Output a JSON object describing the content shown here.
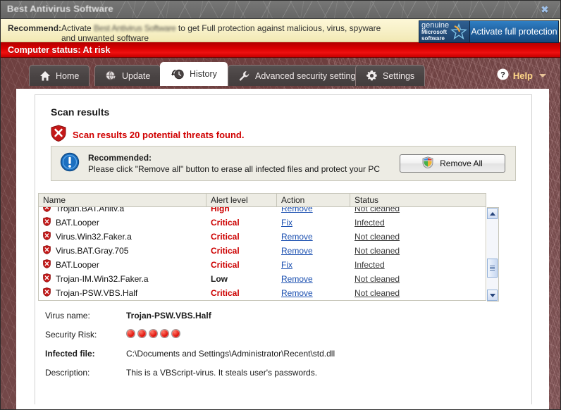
{
  "window": {
    "title": "Best Antivirus Software",
    "close_icon": "close-icon"
  },
  "recommend_bar": {
    "label": "Recommend:",
    "text_before": "Activate",
    "text_blurred": "Best Antivirus Software",
    "text_after": "to get Full protection against malicious, virus, spyware and unwanted software",
    "genuine": {
      "line1": "genuine",
      "line2": "Microsoft",
      "line3": "software"
    },
    "activate_button": "Activate full protection"
  },
  "status_bar": {
    "text": "Computer status: At risk"
  },
  "tabs": [
    {
      "label": "Home",
      "icon": "home-icon",
      "active": false
    },
    {
      "label": "Update",
      "icon": "update-globe-icon",
      "active": false
    },
    {
      "label": "History",
      "icon": "history-clock-icon",
      "active": true
    },
    {
      "label": "Advanced security settings",
      "icon": "wrench-icon",
      "active": false
    },
    {
      "label": "Settings",
      "icon": "gear-icon",
      "active": false
    }
  ],
  "help": {
    "label": "Help",
    "icon": "question-mark-icon"
  },
  "main": {
    "heading": "Scan results",
    "threat_summary": "Scan results 20 potential threats found.",
    "threat_icon": "shield-alert-icon",
    "recommended_box": {
      "icon": "info-exclamation-icon",
      "title": "Recommended:",
      "body": "Please click \"Remove all\" button to erase all infected files and protect your PC",
      "button_label": "Remove All",
      "button_icon": "windows-shield-icon"
    },
    "table": {
      "headers": [
        "Name",
        "Alert level",
        "Action",
        "Status"
      ],
      "rows": [
        {
          "name": "Trojan.BAT.Anitv.a",
          "alert": "High",
          "alert_class": "alert-high",
          "action": "Remove",
          "status": "Not cleaned"
        },
        {
          "name": "BAT.Looper",
          "alert": "Critical",
          "alert_class": "alert-critical",
          "action": "Fix",
          "status": "Infected"
        },
        {
          "name": "Virus.Win32.Faker.a",
          "alert": "Critical",
          "alert_class": "alert-critical",
          "action": "Remove",
          "status": "Not cleaned"
        },
        {
          "name": "Virus.BAT.Gray.705",
          "alert": "Critical",
          "alert_class": "alert-critical",
          "action": "Remove",
          "status": "Not cleaned"
        },
        {
          "name": "BAT.Looper",
          "alert": "Critical",
          "alert_class": "alert-critical",
          "action": "Fix",
          "status": "Infected"
        },
        {
          "name": "Trojan-IM.Win32.Faker.a",
          "alert": "Low",
          "alert_class": "alert-low",
          "action": "Remove",
          "status": "Not cleaned"
        },
        {
          "name": "Trojan-PSW.VBS.Half",
          "alert": "Critical",
          "alert_class": "alert-critical",
          "action": "Remove",
          "status": "Not cleaned"
        }
      ]
    },
    "detail": {
      "virus_name_label": "Virus name:",
      "virus_name_value": "Trojan-PSW.VBS.Half",
      "security_risk_label": "Security Risk:",
      "security_risk_dots": 5,
      "infected_file_label": "Infected file:",
      "infected_file_value": "C:\\Documents and Settings\\Administrator\\Recent\\std.dll",
      "description_label": "Description:",
      "description_value": "This is a VBScript-virus. It steals user's passwords."
    }
  },
  "colors": {
    "accent_red": "#cc0000",
    "status_red": "#d90000",
    "body_maroon": "#6d3f3f",
    "link_blue": "#1a4fb0",
    "activate_blue": "#1f5e9c"
  }
}
